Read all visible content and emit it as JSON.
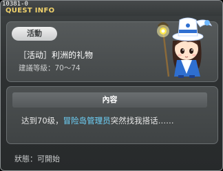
{
  "window": {
    "code": "10381-0",
    "title": "QUEST INFO"
  },
  "quest": {
    "category_badge": "活動",
    "name": "［活动］利洲的礼物",
    "level_range": "建議等級：70～74"
  },
  "content": {
    "header": "內容",
    "text_before": "达到70级，",
    "npc_name": "冒险岛管理员",
    "text_after": "突然找我搭话……"
  },
  "status": {
    "text": "狀態：可開始"
  },
  "npc": {
    "icon": "npc-administrator-girl-with-lantern-staff"
  },
  "colors": {
    "title": "#f2d36b",
    "npc_link": "#6fd6ff",
    "badge_bg": "#e0e2e3"
  }
}
